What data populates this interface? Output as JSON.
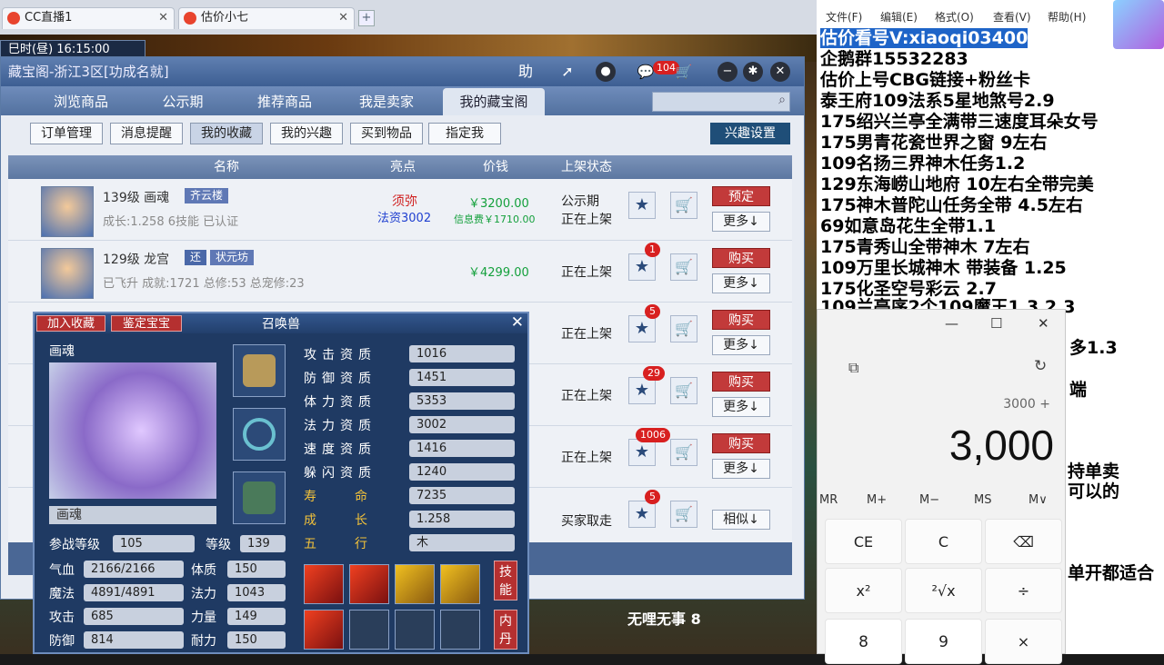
{
  "browser": {
    "tabs": [
      {
        "label": "CC直播1",
        "close": "✕"
      },
      {
        "label": "估价小七",
        "close": "✕"
      }
    ],
    "new_tab": "+"
  },
  "game": {
    "clock": "巳时(昼) 16:15:00",
    "bottom_text": "无哩无事 8"
  },
  "window": {
    "title": "藏宝阁-浙江3区[功成名就]",
    "help": "助",
    "mail_count": "104",
    "nav_tabs": [
      "浏览商品",
      "公示期",
      "推荐商品",
      "我是卖家",
      "我的藏宝阁"
    ],
    "sub_tabs": [
      "订单管理",
      "消息提醒",
      "我的收藏",
      "我的兴趣",
      "买到物品",
      "指定我"
    ],
    "interest_btn": "兴趣设置",
    "headers": {
      "name": "名称",
      "highlight": "亮点",
      "price": "价钱",
      "status": "上架状态"
    },
    "rows": [
      {
        "level": "139级 画魂",
        "server": "齐云楼",
        "desc": "成长:1.258 6技能 已认证",
        "highlight1": "须弥",
        "highlight2": "法资3002",
        "price": "￥3200.00",
        "fee": "信息费￥1710.00",
        "status1": "公示期",
        "status2": "正在上架",
        "count": "",
        "action": "预定",
        "more": "更多↓"
      },
      {
        "level": "129级 龙宫",
        "tag": "还",
        "server": "状元坊",
        "desc": "已飞升 成就:1721 总修:53 总宠修:23",
        "price": "￥4299.00",
        "status1": "正在上架",
        "count": "1",
        "action": "购买",
        "more": "更多↓"
      },
      {
        "status1": "正在上架",
        "count": "5",
        "action": "购买",
        "more": "更多↓"
      },
      {
        "status1": "正在上架",
        "count": "29",
        "action": "购买",
        "more": "更多↓"
      },
      {
        "status1": "正在上架",
        "count": "1006",
        "action": "购买",
        "more": "更多↓"
      },
      {
        "status1": "买家取走",
        "count": "5",
        "action": "",
        "more": "相似↓"
      }
    ]
  },
  "pet": {
    "add_fav": "加入收藏",
    "appraise": "鉴定宝宝",
    "title": "召唤兽",
    "name": "画魂",
    "name_field": "画魂",
    "aptitudes": [
      {
        "label": "攻击资质",
        "value": "1016"
      },
      {
        "label": "防御资质",
        "value": "1451"
      },
      {
        "label": "体力资质",
        "value": "5353"
      },
      {
        "label": "法力资质",
        "value": "3002"
      },
      {
        "label": "速度资质",
        "value": "1416"
      },
      {
        "label": "躲闪资质",
        "value": "1240"
      },
      {
        "label": "寿命",
        "value": "7235"
      },
      {
        "label": "成长",
        "value": "1.258"
      },
      {
        "label": "五行",
        "value": "木"
      }
    ],
    "battle_level_label": "参战等级",
    "battle_level": "105",
    "level_label": "等级",
    "level": "139",
    "stats": [
      {
        "label": "气血",
        "value": "2166/2166",
        "label2": "体质",
        "value2": "150"
      },
      {
        "label": "魔法",
        "value": "4891/4891",
        "label2": "法力",
        "value2": "1043"
      },
      {
        "label": "攻击",
        "value": "685",
        "label2": "力量",
        "value2": "149"
      },
      {
        "label": "防御",
        "value": "814",
        "label2": "耐力",
        "value2": "150"
      }
    ],
    "skill_btn": "技能",
    "neidan_btn": "内丹"
  },
  "notepad": {
    "menu": [
      "文件(F)",
      "编辑(E)",
      "格式(O)",
      "查看(V)",
      "帮助(H)"
    ],
    "lines": [
      "估价看号V:xiaoqi03400",
      "企鹅群15532283",
      "估价上号CBG链接+粉丝卡",
      "泰王府109法系5星地煞号2.9",
      "175绍兴兰亭全满带三速度耳朵女号",
      "175男青花瓷世界之窗  9左右",
      "109名扬三界神木任务1.2",
      "129东海崂山地府 10左右全带完美",
      "175神木普陀山任务全带 4.5左右",
      "69如意岛花生全带1.1",
      "175青秀山全带神木  7左右",
      "109万里长城神木 带装备  1.25",
      "175化圣空号彩云 2.7",
      "109兰亭序2个109魔王1.3 2.3"
    ],
    "partial": [
      "多1.3",
      "端",
      "持单卖",
      "可以的",
      "单开都适合"
    ]
  },
  "calculator": {
    "expression": "3000 +",
    "display": "3,000",
    "memory": [
      "MR",
      "M+",
      "M−",
      "MS",
      "M∨"
    ],
    "keys": [
      "CE",
      "C",
      "⌫",
      "x²",
      "²√x",
      "÷",
      "8",
      "9",
      "×"
    ]
  }
}
